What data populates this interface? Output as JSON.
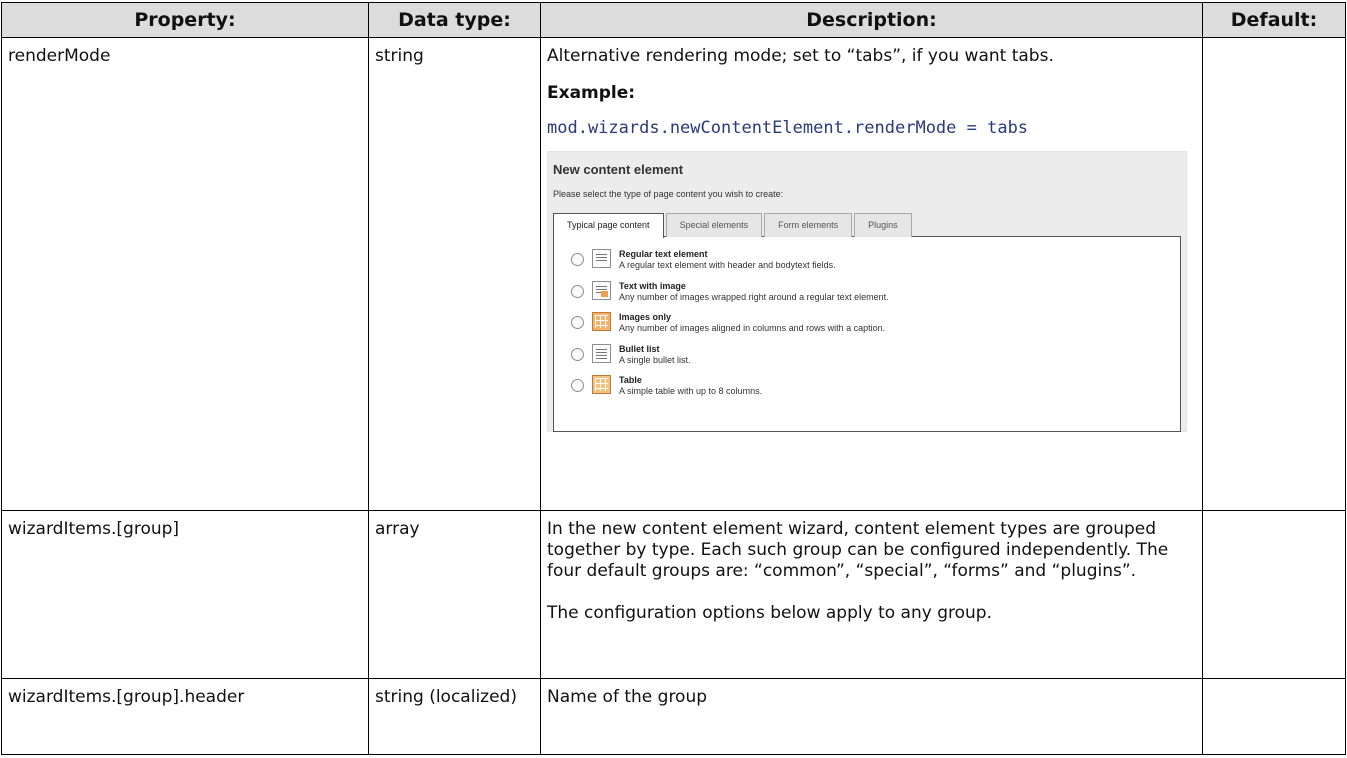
{
  "headers": {
    "property": "Property:",
    "datatype": "Data type:",
    "description": "Description:",
    "default": "Default:"
  },
  "rows": [
    {
      "property": "renderMode",
      "datatype": "string",
      "desc": "Alternative rendering mode; set to “tabs”, if you want tabs.",
      "example_label": "Example:",
      "example_code": "mod.wizards.newContentElement.renderMode = tabs",
      "default": ""
    },
    {
      "property": "wizardItems.[group]",
      "datatype": "array",
      "desc": "In the new content element wizard, content element types are grouped together by type. Each such group can be configured independently. The four default groups are: “common”, “special”, “forms” and “plugins”.",
      "desc2": "The configuration options below apply to any group.",
      "default": ""
    },
    {
      "property": "wizardItems.[group].header",
      "datatype": "string (localized)",
      "desc": "Name of the group",
      "default": ""
    }
  ],
  "screenshot": {
    "title": "New content element",
    "subtitle": "Please select the type of page content you wish to create:",
    "tabs": [
      "Typical page content",
      "Special elements",
      "Form elements",
      "Plugins"
    ],
    "items": [
      {
        "title": "Regular text element",
        "desc": "A regular text element with header and bodytext fields.",
        "icon": "text-element-icon"
      },
      {
        "title": "Text with image",
        "desc": "Any number of images wrapped right around a regular text element.",
        "icon": "text-image-icon"
      },
      {
        "title": "Images only",
        "desc": "Any number of images aligned in columns and rows with a caption.",
        "icon": "images-icon"
      },
      {
        "title": "Bullet list",
        "desc": "A single bullet list.",
        "icon": "bullet-list-icon"
      },
      {
        "title": "Table",
        "desc": "A simple table with up to 8 columns.",
        "icon": "table-icon"
      }
    ]
  }
}
